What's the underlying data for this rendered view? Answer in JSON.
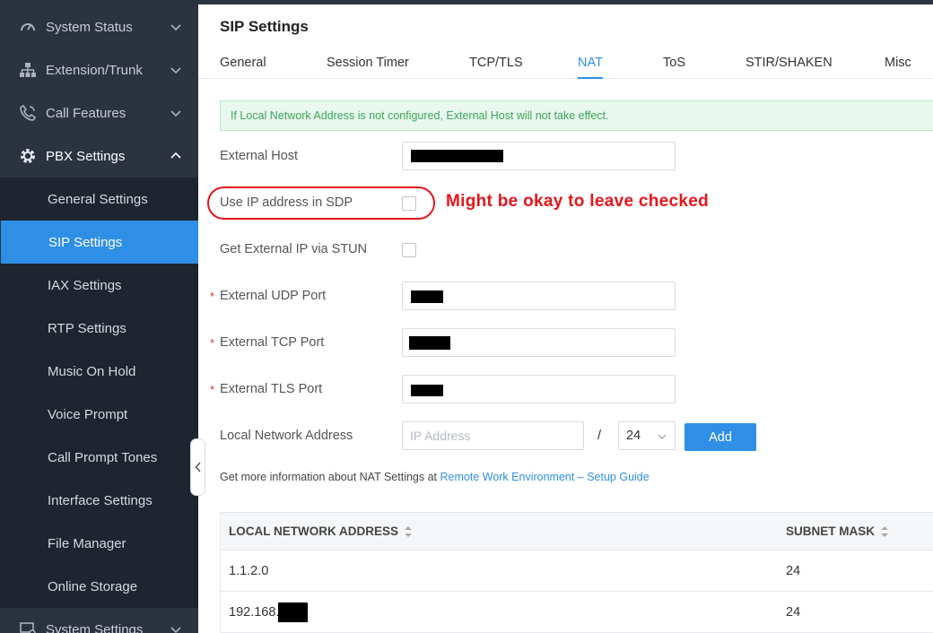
{
  "sidebar": {
    "top_items": [
      {
        "label": "System Status",
        "icon": "gauge-icon"
      },
      {
        "label": "Extension/Trunk",
        "icon": "network-icon"
      },
      {
        "label": "Call Features",
        "icon": "phone-icon"
      },
      {
        "label": "PBX Settings",
        "icon": "gear-icon"
      }
    ],
    "sub_items": [
      {
        "label": "General Settings"
      },
      {
        "label": "SIP Settings",
        "active": true
      },
      {
        "label": "IAX Settings"
      },
      {
        "label": "RTP Settings"
      },
      {
        "label": "Music On Hold"
      },
      {
        "label": "Voice Prompt"
      },
      {
        "label": "Call Prompt Tones"
      },
      {
        "label": "Interface Settings"
      },
      {
        "label": "File Manager"
      },
      {
        "label": "Online Storage"
      }
    ],
    "bottom_item": {
      "label": "System Settings",
      "icon": "monitor-gear-icon"
    }
  },
  "page": {
    "title": "SIP Settings"
  },
  "tabs": [
    "General",
    "Session Timer",
    "TCP/TLS",
    "NAT",
    "ToS",
    "STIR/SHAKEN",
    "Misc"
  ],
  "active_tab": "NAT",
  "notice": "If Local Network Address is not configured, External Host will not take effect.",
  "form": {
    "external_host": {
      "label": "External Host"
    },
    "use_ip_in_sdp": {
      "label": "Use IP address in SDP",
      "checked": false
    },
    "get_ip_via_stun": {
      "label": "Get External IP via STUN",
      "checked": false
    },
    "external_udp_port": {
      "label": "External UDP Port",
      "required": "*"
    },
    "external_tcp_port": {
      "label": "External TCP Port",
      "required": "*"
    },
    "external_tls_port": {
      "label": "External TLS Port",
      "required": "*"
    },
    "local_network": {
      "label": "Local Network Address",
      "ip_placeholder": "IP Address",
      "slash": "/",
      "mask_value": "24",
      "add_label": "Add"
    }
  },
  "annotation": {
    "text": "Might be okay to leave checked"
  },
  "info": {
    "prefix": "Get more information about NAT Settings at ",
    "link": "Remote Work Environment – Setup Guide"
  },
  "table": {
    "headers": [
      "LOCAL NETWORK ADDRESS",
      "SUBNET MASK"
    ],
    "rows": [
      {
        "address": "1.1.2.0",
        "mask": "24"
      },
      {
        "address": "192.168.",
        "mask": "24"
      }
    ]
  },
  "colors": {
    "sidebar_bg": "#2c3340",
    "submenu_bg": "#1e2530",
    "accent": "#2f8fe6",
    "notice_text": "#3ca557",
    "annotation_red": "#e8141b"
  }
}
